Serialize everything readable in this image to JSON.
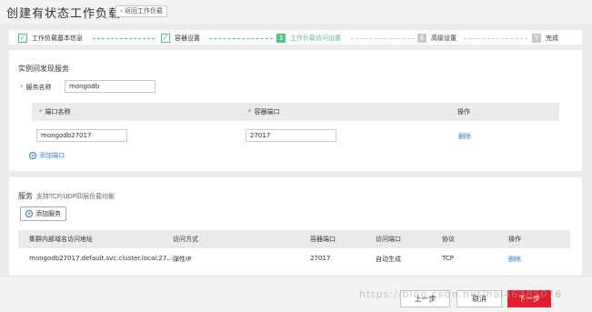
{
  "header": {
    "title": "创建有状态工作负载",
    "back_label": "返回工作负载",
    "back_icon": "chevron-left-icon"
  },
  "steps": [
    {
      "label": "工作负载基本信息",
      "state": "done",
      "mark": "✓"
    },
    {
      "label": "容器设置",
      "state": "done",
      "mark": "✓"
    },
    {
      "label": "工作负载访问设置",
      "state": "active",
      "mark": "3"
    },
    {
      "label": "高级设置",
      "state": "todo",
      "mark": "4"
    },
    {
      "label": "完成",
      "state": "todo",
      "mark": "5"
    }
  ],
  "discovery": {
    "title": "实例间发现服务",
    "service_name_label": "服务名称",
    "service_name_value": "mongodb",
    "required_mark": "*",
    "port_table": {
      "col_port_name": "端口名称",
      "col_container_port": "容器端口",
      "col_action": "操作",
      "row": {
        "port_name": "mongodb27017",
        "container_port": "27017",
        "action": "删除"
      }
    },
    "add_port_label": "添加端口"
  },
  "service": {
    "title": "服务",
    "subtitle": "支持TCP/UDP四层负载均衡",
    "add_service_label": "添加服务",
    "table": {
      "headers": [
        "集群内部域名访问地址",
        "访问方式",
        "容器端口",
        "访问端口",
        "协议",
        "操作"
      ],
      "row": {
        "address": "mongodb27017.default.svc.cluster.local:27…",
        "access_type": "弹性IP",
        "container_port": "27017",
        "access_port": "自动生成",
        "protocol": "TCP",
        "action": "删除"
      }
    }
  },
  "footer": {
    "prev_label": "上一步",
    "cancel_label": "取消",
    "next_label": "下一步"
  },
  "watermark": "https://blog.csdn.net/hai46385076",
  "colors": {
    "accent_green": "#5cbf86",
    "link_blue": "#2f80c0",
    "primary_red": "#e0202f",
    "required_red": "#e0503a"
  }
}
